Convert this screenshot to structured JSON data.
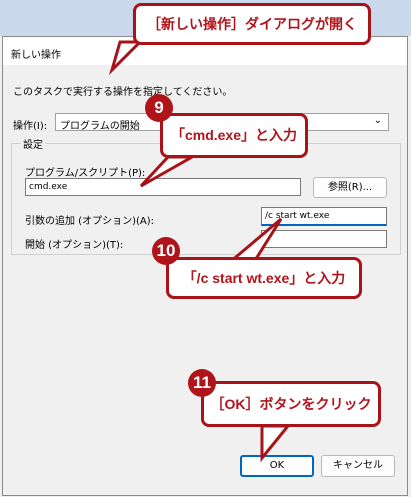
{
  "callouts": {
    "top": "［新しい操作］ダイアログが開く",
    "step9_num": "9",
    "step9_text": "「cmd.exe」と入力",
    "step10_num": "10",
    "step10_text": "「/c start wt.exe」と入力",
    "step11_num": "11",
    "step11_text": "［OK］ボタンをクリック"
  },
  "dialog": {
    "title": "新しい操作",
    "description": "このタスクで実行する操作を指定してください。",
    "action_label": "操作(I):",
    "action_value": "プログラムの開始",
    "settings_label": "設定",
    "program_label": "プログラム/スクリプト(P):",
    "program_value": "cmd.exe",
    "browse_label": "参照(R)...",
    "args_label": "引数の追加 (オプション)(A):",
    "args_value": "/c start wt.exe",
    "start_label": "開始 (オプション)(T):",
    "start_value": "",
    "ok_label": "OK",
    "cancel_label": "キャンセル"
  },
  "colors": {
    "accent": "#0067c0",
    "callout_red": "#b0141b"
  }
}
